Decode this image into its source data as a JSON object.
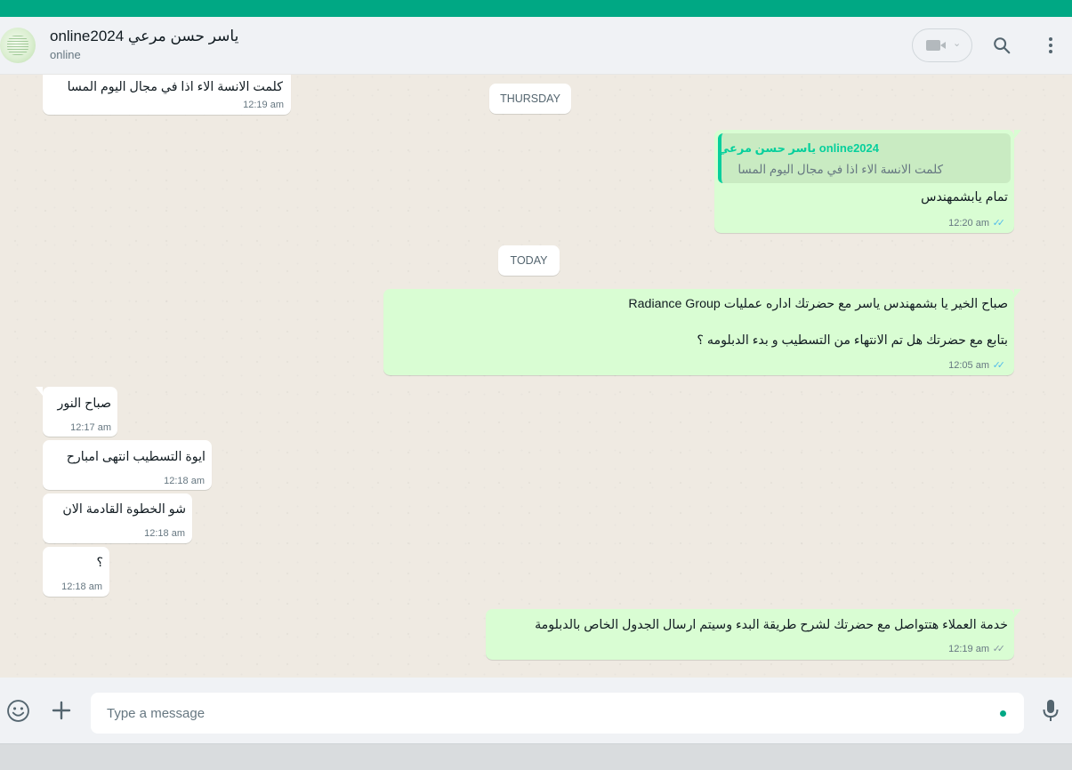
{
  "header": {
    "contact_name": "online2024 ياسر حسن مرعي",
    "status": "online",
    "avatar_icon": "contact-avatar",
    "video_icon": "video-camera-icon",
    "search_icon": "search-icon",
    "menu_icon": "more-vertical-icon"
  },
  "dates": {
    "thursday": "THURSDAY",
    "today": "TODAY"
  },
  "messages": {
    "m0": {
      "direction": "incoming",
      "text": "كلمت الانسة الاء اذا في مجال اليوم المسا",
      "time": "12:19 am"
    },
    "m1": {
      "direction": "outgoing",
      "quoted_name": "online2024 ياسر حسن مرعي",
      "quoted_text": "كلمت الانسة الاء اذا في مجال اليوم المسا",
      "text": "تمام يابشمهندس",
      "time": "12:20 am",
      "status": "read"
    },
    "m2": {
      "direction": "outgoing",
      "line1": "صباح الخير يا بشمهندس ياسر مع  حضرتك اداره عمليات Radiance Group",
      "line2": "بتابع مع حضرتك هل تم الانتهاء من التسطيب و بدء الدبلومه ؟",
      "time": "12:05 am",
      "status": "read"
    },
    "m3": {
      "direction": "incoming",
      "text": "صباح النور",
      "time": "12:17 am"
    },
    "m4": {
      "direction": "incoming",
      "text": "ايوة التسطيب انتهى امبارح",
      "time": "12:18 am"
    },
    "m5": {
      "direction": "incoming",
      "text": "شو الخطوة القادمة الان",
      "time": "12:18 am"
    },
    "m6": {
      "direction": "incoming",
      "text": "؟",
      "time": "12:18 am"
    },
    "m7": {
      "direction": "outgoing",
      "text": "خدمة العملاء هتتواصل مع حضرتك لشرح طريقة البدء وسيتم ارسال الجدول الخاص بالدبلومة",
      "time": "12:19 am",
      "status": "delivered"
    }
  },
  "composer": {
    "placeholder": "Type a message",
    "emoji_icon": "emoji-icon",
    "attach_icon": "plus-icon",
    "mic_icon": "microphone-icon"
  },
  "colors": {
    "accent": "#00a884",
    "outgoing_bubble": "#d9fdd3",
    "incoming_bubble": "#ffffff",
    "read_ticks": "#53bdeb",
    "chat_background": "#efeae2"
  }
}
